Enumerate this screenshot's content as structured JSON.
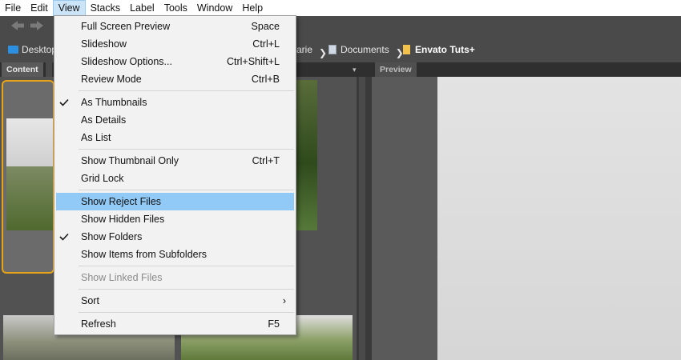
{
  "menubar": {
    "items": [
      "File",
      "Edit",
      "View",
      "Stacks",
      "Label",
      "Tools",
      "Window",
      "Help"
    ]
  },
  "path": {
    "crumbs": [
      "Desktop",
      "arie",
      "Documents",
      "Envato Tuts+"
    ]
  },
  "panels": {
    "content_tab": "Content",
    "preview_tab": "Preview"
  },
  "view_menu": {
    "items": [
      {
        "label": "Full Screen Preview",
        "shortcut": "Space"
      },
      {
        "label": "Slideshow",
        "shortcut": "Ctrl+L"
      },
      {
        "label": "Slideshow Options...",
        "shortcut": "Ctrl+Shift+L"
      },
      {
        "label": "Review Mode",
        "shortcut": "Ctrl+B"
      },
      {
        "label": "As Thumbnails"
      },
      {
        "label": "As Details"
      },
      {
        "label": "As List"
      },
      {
        "label": "Show Thumbnail Only",
        "shortcut": "Ctrl+T"
      },
      {
        "label": "Grid Lock"
      },
      {
        "label": "Show Reject Files"
      },
      {
        "label": "Show Hidden Files"
      },
      {
        "label": "Show Folders"
      },
      {
        "label": "Show Items from Subfolders"
      },
      {
        "label": "Show Linked Files"
      },
      {
        "label": "Sort"
      },
      {
        "label": "Refresh",
        "shortcut": "F5"
      }
    ]
  },
  "colors": {
    "menu_highlight": "#91c9f7",
    "selection_border": "#e8a317",
    "folder_blue": "#2d8fe0",
    "folder_yellow": "#f2c24a"
  }
}
